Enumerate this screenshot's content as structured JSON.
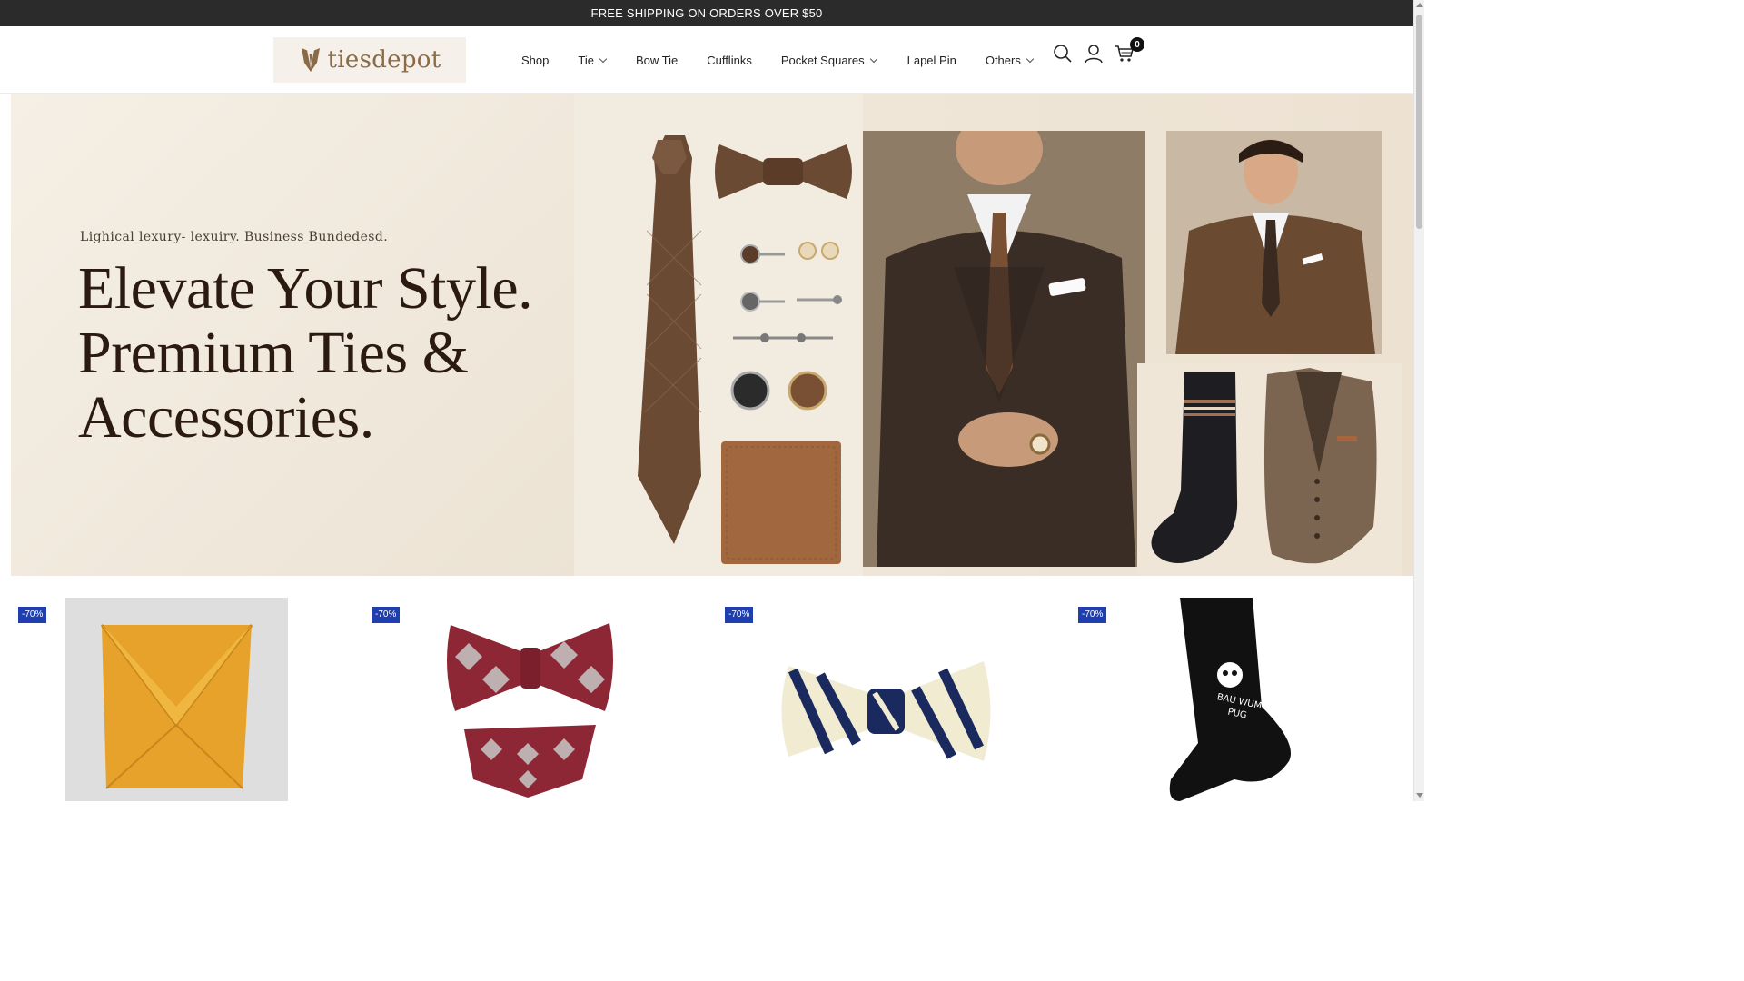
{
  "announcement": {
    "text": "FREE SHIPPING ON ORDERS OVER $50"
  },
  "header": {
    "logo_text": "tiesdepot",
    "nav": [
      {
        "label": "Shop",
        "has_dropdown": false
      },
      {
        "label": "Tie",
        "has_dropdown": true
      },
      {
        "label": "Bow Tie",
        "has_dropdown": false
      },
      {
        "label": "Cufflinks",
        "has_dropdown": false
      },
      {
        "label": "Pocket Squares",
        "has_dropdown": true
      },
      {
        "label": "Lapel Pin",
        "has_dropdown": false
      },
      {
        "label": "Others",
        "has_dropdown": true
      }
    ],
    "icons": [
      "search-icon",
      "account-icon",
      "cart-icon"
    ],
    "cart_count": "0"
  },
  "hero": {
    "eyebrow": "Lighical lexury- lexuiry. Business Bundedesd.",
    "title_lines": [
      "Elevate Your Style.",
      "Premium Ties &",
      "Accessories."
    ]
  },
  "products": [
    {
      "badge": "-70%",
      "image": "gold-silk-tie"
    },
    {
      "badge": "-70%",
      "image": "argyle-bow-tie-and-pocket-square"
    },
    {
      "badge": "-70%",
      "image": "navy-cream-striped-bow-tie"
    },
    {
      "badge": "-70%",
      "image": "black-pug-socks"
    }
  ],
  "colors": {
    "announcement_bg": "#2b2b2b",
    "badge_bg": "#1f3fb0",
    "logo_brown": "#8a6a47",
    "hero_text": "#2a1a10"
  }
}
